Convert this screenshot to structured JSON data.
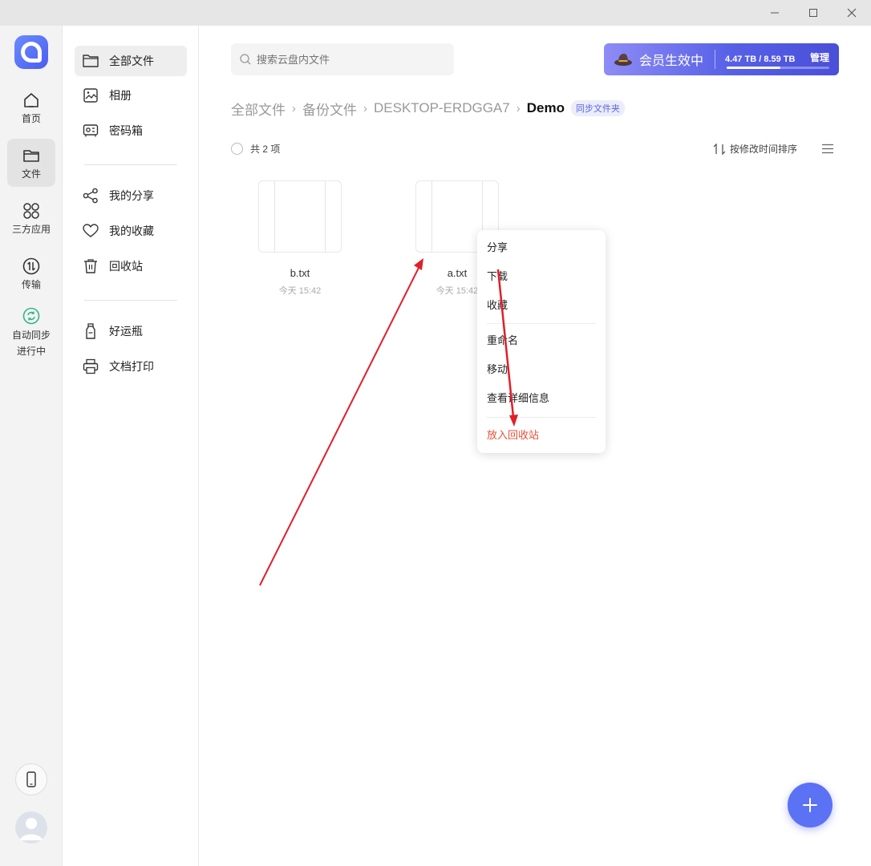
{
  "window": {
    "minimize_icon": "minimize-icon",
    "maximize_icon": "maximize-icon",
    "close_icon": "close-icon"
  },
  "rail": {
    "items": [
      {
        "label": "首页",
        "icon": "home-icon"
      },
      {
        "label": "文件",
        "icon": "folder-icon"
      },
      {
        "label": "三方应用",
        "icon": "apps-icon"
      },
      {
        "label": "传输",
        "icon": "transfer-icon"
      }
    ],
    "sync_line1": "自动同步",
    "sync_line2": "进行中"
  },
  "sidebar": {
    "items": [
      {
        "label": "全部文件",
        "icon": "folder-icon"
      },
      {
        "label": "相册",
        "icon": "photo-icon"
      },
      {
        "label": "密码箱",
        "icon": "safe-icon"
      },
      {
        "label": "我的分享",
        "icon": "share-icon"
      },
      {
        "label": "我的收藏",
        "icon": "heart-icon"
      },
      {
        "label": "回收站",
        "icon": "trash-icon"
      },
      {
        "label": "好运瓶",
        "icon": "bottle-icon"
      },
      {
        "label": "文档打印",
        "icon": "printer-icon"
      }
    ]
  },
  "search": {
    "placeholder": "搜索云盘内文件"
  },
  "vip": {
    "status": "会员生效中",
    "storage": "4.47 TB / 8.59 TB",
    "used_fraction": 0.52,
    "manage": "管理",
    "colors": {
      "start": "#8e8cf5",
      "end": "#4a4fd8"
    }
  },
  "breadcrumb": {
    "items": [
      "全部文件",
      "备份文件",
      "DESKTOP-ERDGGA7"
    ],
    "current": "Demo",
    "tag": "同步文件夹"
  },
  "toolbar": {
    "count": "共 2 项",
    "sort": "按修改时间排序"
  },
  "files": [
    {
      "name": "b.txt",
      "time": "今天 15:42"
    },
    {
      "name": "a.txt",
      "time": "今天 15:42"
    }
  ],
  "context_menu": {
    "items": [
      "分享",
      "下载",
      "收藏",
      "重命名",
      "移动",
      "查看详细信息"
    ],
    "danger": "放入回收站",
    "danger_color": "#e8503a"
  },
  "colors": {
    "accent": "#5b72f5",
    "annotation": "#e01f2a"
  }
}
